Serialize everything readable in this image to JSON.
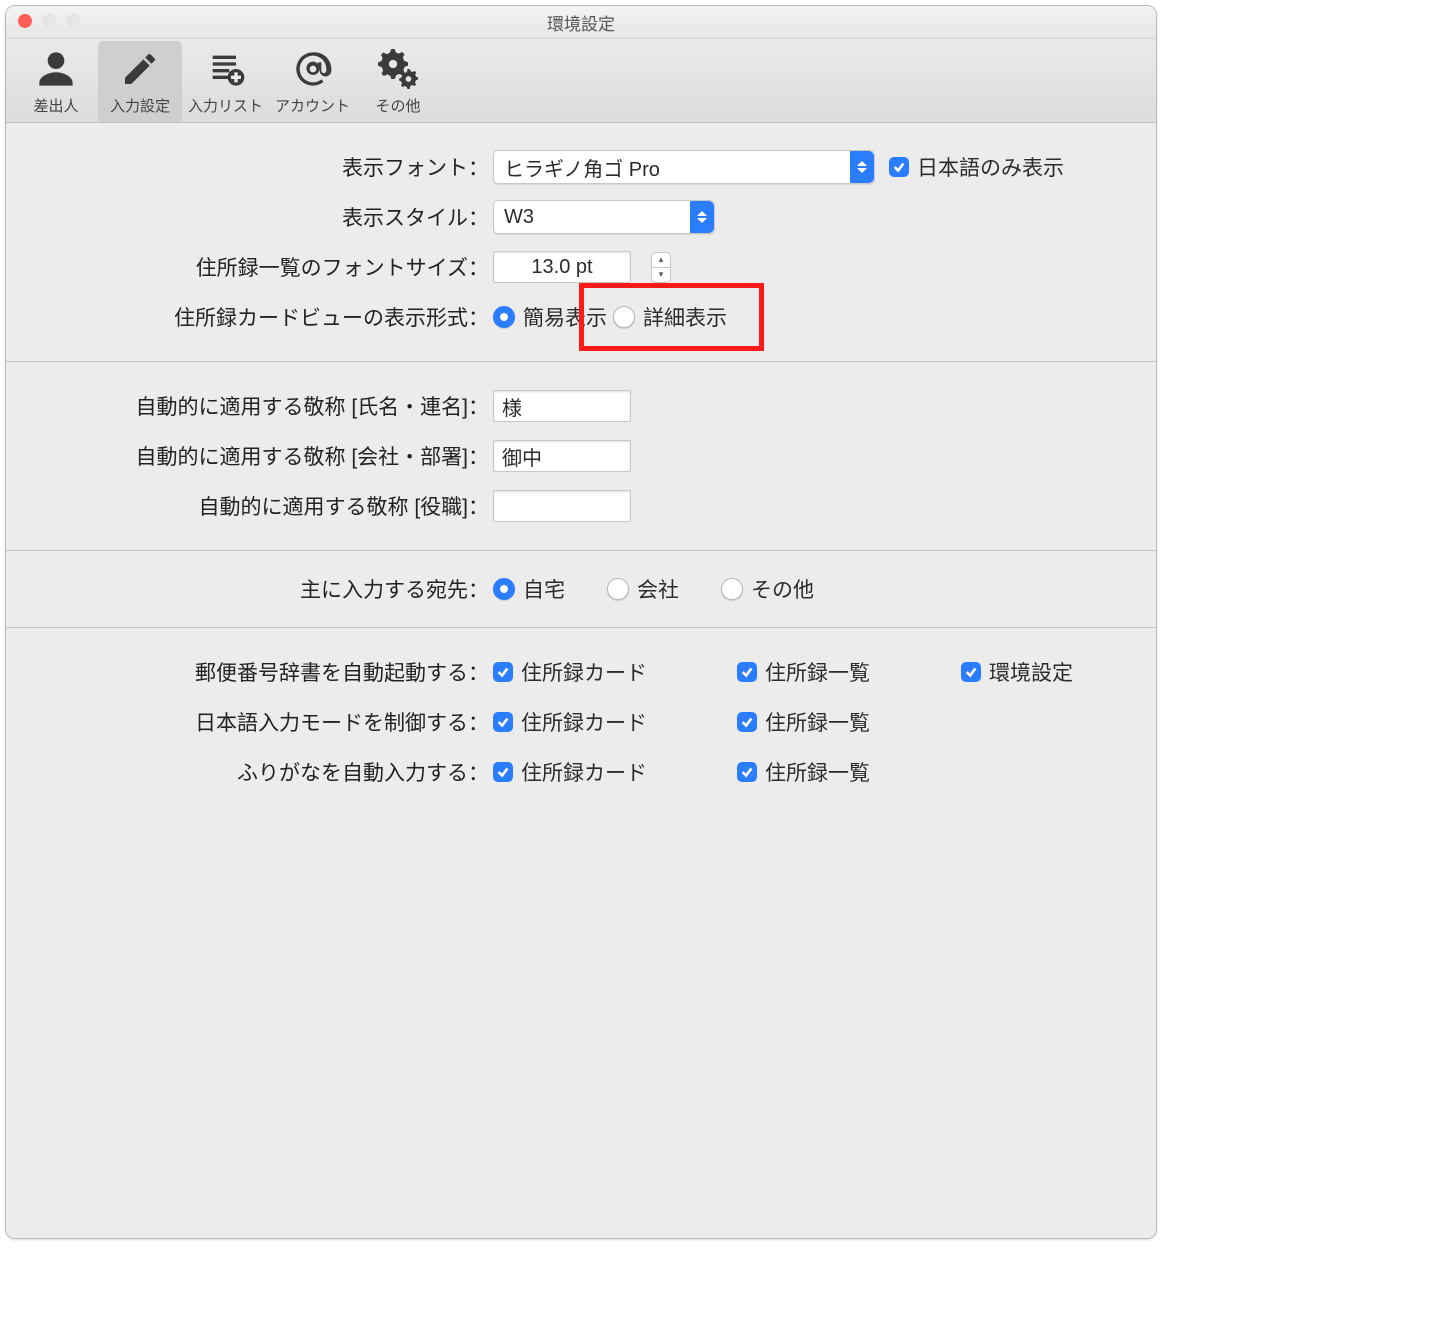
{
  "window": {
    "title": "環境設定"
  },
  "toolbar": {
    "items": [
      {
        "key": "sender",
        "label": "差出人"
      },
      {
        "key": "input",
        "label": "入力設定"
      },
      {
        "key": "list",
        "label": "入力リスト"
      },
      {
        "key": "account",
        "label": "アカウント"
      },
      {
        "key": "other",
        "label": "その他"
      }
    ],
    "active": "input"
  },
  "section1": {
    "font_label": "表示フォント：",
    "font_value": "ヒラギノ角ゴ Pro",
    "jp_only_label": "日本語のみ表示",
    "jp_only_checked": true,
    "style_label": "表示スタイル：",
    "style_value": "W3",
    "size_label": "住所録一覧のフォントサイズ：",
    "size_value": "13.0 pt",
    "viewmode_label": "住所録カードビューの表示形式：",
    "viewmode_options": {
      "simple": "簡易表示",
      "detail": "詳細表示"
    },
    "viewmode_selected": "simple"
  },
  "section2": {
    "name_label": "自動的に適用する敬称 [氏名・連名]：",
    "name_value": "様",
    "company_label": "自動的に適用する敬称 [会社・部署]：",
    "company_value": "御中",
    "role_label": "自動的に適用する敬称 [役職]：",
    "role_value": ""
  },
  "section3": {
    "label": "主に入力する宛先：",
    "options": {
      "home": "自宅",
      "company": "会社",
      "other": "その他"
    },
    "selected": "home"
  },
  "section4": {
    "rows": [
      {
        "label": "郵便番号辞書を自動起動する：",
        "cols": [
          {
            "label": "住所録カード",
            "checked": true
          },
          {
            "label": "住所録一覧",
            "checked": true
          },
          {
            "label": "環境設定",
            "checked": true
          }
        ]
      },
      {
        "label": "日本語入力モードを制御する：",
        "cols": [
          {
            "label": "住所録カード",
            "checked": true
          },
          {
            "label": "住所録一覧",
            "checked": true
          }
        ]
      },
      {
        "label": "ふりがなを自動入力する：",
        "cols": [
          {
            "label": "住所録カード",
            "checked": true
          },
          {
            "label": "住所録一覧",
            "checked": true
          }
        ]
      }
    ]
  }
}
